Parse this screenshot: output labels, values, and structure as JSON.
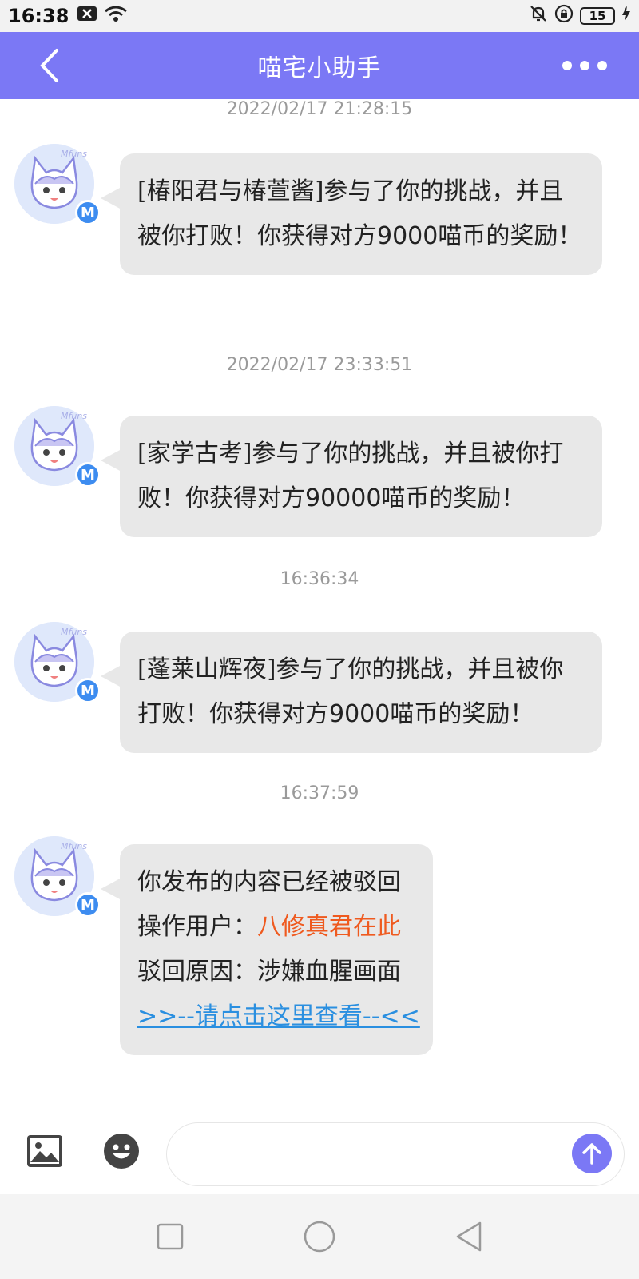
{
  "status_bar": {
    "time": "16:38",
    "battery": "15"
  },
  "header": {
    "title": "喵宅小助手"
  },
  "messages": [
    {
      "timestamp": "2022/02/17 21:28:15",
      "text": "[椿阳君与椿萱酱]参与了你的挑战，并且被你打败！你获得对方9000喵币的奖励！"
    },
    {
      "timestamp": "2022/02/17 23:33:51",
      "text": "[家学古考]参与了你的挑战，并且被你打败！你获得对方90000喵币的奖励！"
    },
    {
      "timestamp": "16:36:34",
      "text": "[蓬莱山辉夜]参与了你的挑战，并且被你打败！你获得对方9000喵币的奖励！"
    },
    {
      "timestamp": "16:37:59",
      "line1": "你发布的内容已经被驳回",
      "operator_label": "操作用户：",
      "operator_name": "八修真君在此",
      "reason_label": "驳回原因：",
      "reason": "涉嫌血腥画面",
      "link": ">>--请点击这里查看--<<"
    }
  ],
  "avatar": {
    "badge": "M",
    "brand": "Mfuns"
  },
  "colors": {
    "header": "#7b78f5",
    "accent": "#ef5a1f",
    "link": "#2a8fe0",
    "bubble": "#e8e8e8"
  },
  "icons": {
    "back": "chevron-left-icon",
    "more": "more-dots-icon",
    "image": "image-icon",
    "emoji": "emoji-icon",
    "send": "arrow-up-icon"
  }
}
